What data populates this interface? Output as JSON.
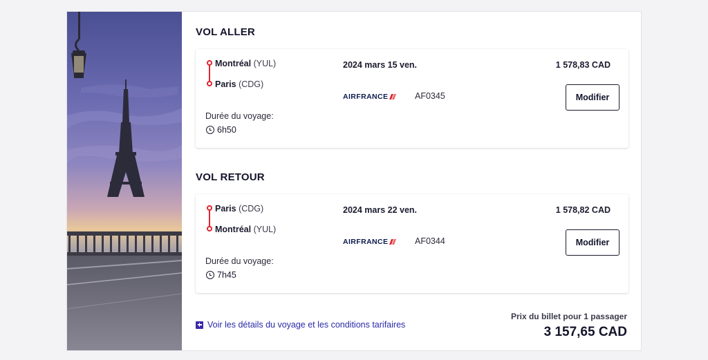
{
  "outbound": {
    "section_title": "VOL ALLER",
    "origin_city": "Montréal",
    "origin_code": "(YUL)",
    "destination_city": "Paris",
    "destination_code": "(CDG)",
    "duration_label": "Durée du voyage:",
    "duration": "6h50",
    "date": "2024 mars 15 ven.",
    "airline": "AIRFRANCE",
    "flight_number": "AF0345",
    "price": "1 578,83 CAD",
    "modify_label": "Modifier"
  },
  "return": {
    "section_title": "VOL RETOUR",
    "origin_city": "Paris",
    "origin_code": "(CDG)",
    "destination_city": "Montréal",
    "destination_code": "(YUL)",
    "duration_label": "Durée du voyage:",
    "duration": "7h45",
    "date": "2024 mars 22 ven.",
    "airline": "AIRFRANCE",
    "flight_number": "AF0344",
    "price": "1 578,82 CAD",
    "modify_label": "Modifier"
  },
  "footer": {
    "details_link": "Voir les détails du voyage et les conditions tarifaires",
    "ticket_price_label": "Prix du billet pour 1 passager",
    "ticket_total": "3 157,65 CAD"
  },
  "icons": {
    "route": "route-dots-icon",
    "duration": "clock-icon",
    "details": "plus-square-icon",
    "airline": "airfrance-logo"
  },
  "colors": {
    "route_accent": "#e0262f",
    "link": "#2a2aa8",
    "airline_navy": "#0b1b4d"
  }
}
